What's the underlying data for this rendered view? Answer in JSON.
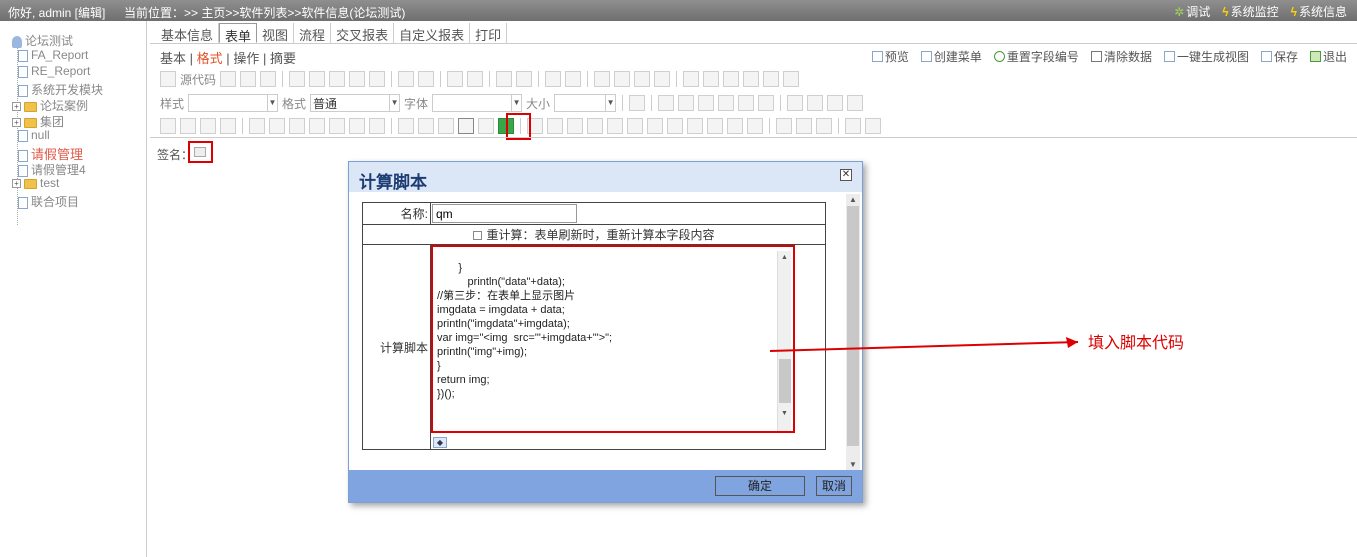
{
  "topbar": {
    "greeting": "你好, admin [编辑]",
    "breadcrumb": "当前位置：>> 主页>>软件列表>>软件信息(论坛测试)",
    "right_items": [
      "调试",
      "系统监控",
      "系统信息"
    ]
  },
  "tree": {
    "root": "论坛测试",
    "items": [
      "FA_Report",
      "RE_Report",
      "系统开发模块",
      "论坛案例",
      "集团",
      "null",
      "请假管理",
      "请假管理4",
      "test",
      "联合项目"
    ]
  },
  "tabs": [
    "基本信息",
    "表单",
    "视图",
    "流程",
    "交叉报表",
    "自定义报表",
    "打印"
  ],
  "subtabs": {
    "a": "基本",
    "b": "格式",
    "c": "操作",
    "d": "摘要",
    "sep": "|"
  },
  "actions": [
    "预览",
    "创建菜单",
    "重置字段编号",
    "清除数据",
    "一键生成视图",
    "保存",
    "退出"
  ],
  "toolbar": {
    "source": "源代码",
    "style_label": "样式",
    "format_label": "格式",
    "format_value": "普通",
    "font_label": "字体",
    "size_label": "大小"
  },
  "form": {
    "signature_label": "签名："
  },
  "dialog": {
    "title": "计算脚本",
    "name_label": "名称:",
    "name_value": "qm",
    "recalc_label": "重计算：表单刷新时，重新计算本字段内容",
    "script_label": "计算脚本",
    "code": "       }\n          println(\"data\"+data);\n//第三步：在表单上显示图片\nimgdata = imgdata + data;\nprintln(\"imgdata\"+imgdata);\nvar img=\"<img  src='\"+imgdata+\"'>\";\nprintln(\"img\"+img);\n}\nreturn img;\n})();",
    "ok": "确定",
    "cancel": "取消"
  },
  "annotation": "填入脚本代码"
}
